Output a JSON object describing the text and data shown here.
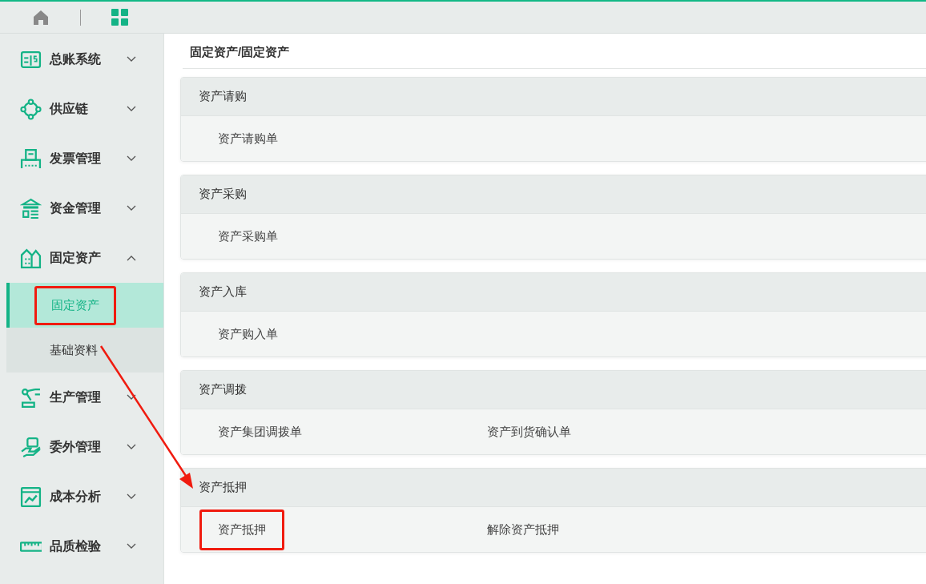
{
  "sidebar": {
    "items": [
      {
        "label": "总账系统",
        "expanded": false
      },
      {
        "label": "供应链",
        "expanded": false
      },
      {
        "label": "发票管理",
        "expanded": false
      },
      {
        "label": "资金管理",
        "expanded": false
      },
      {
        "label": "固定资产",
        "expanded": true,
        "children": [
          {
            "label": "固定资产",
            "selected": true,
            "highlighted": true
          },
          {
            "label": "基础资料",
            "selected": false,
            "highlighted": false
          }
        ]
      },
      {
        "label": "生产管理",
        "expanded": false
      },
      {
        "label": "委外管理",
        "expanded": false
      },
      {
        "label": "成本分析",
        "expanded": false
      },
      {
        "label": "品质检验",
        "expanded": false
      }
    ]
  },
  "breadcrumb": "固定资产/固定资产",
  "sections": [
    {
      "title": "资产请购",
      "links": [
        {
          "label": "资产请购单",
          "highlighted": false
        }
      ]
    },
    {
      "title": "资产采购",
      "links": [
        {
          "label": "资产采购单",
          "highlighted": false
        }
      ]
    },
    {
      "title": "资产入库",
      "links": [
        {
          "label": "资产购入单",
          "highlighted": false
        }
      ]
    },
    {
      "title": "资产调拨",
      "links": [
        {
          "label": "资产集团调拨单",
          "highlighted": false
        },
        {
          "label": "资产到货确认单",
          "highlighted": false
        }
      ]
    },
    {
      "title": "资产抵押",
      "links": [
        {
          "label": "资产抵押",
          "highlighted": true
        },
        {
          "label": "解除资产抵押",
          "highlighted": false
        }
      ]
    }
  ]
}
